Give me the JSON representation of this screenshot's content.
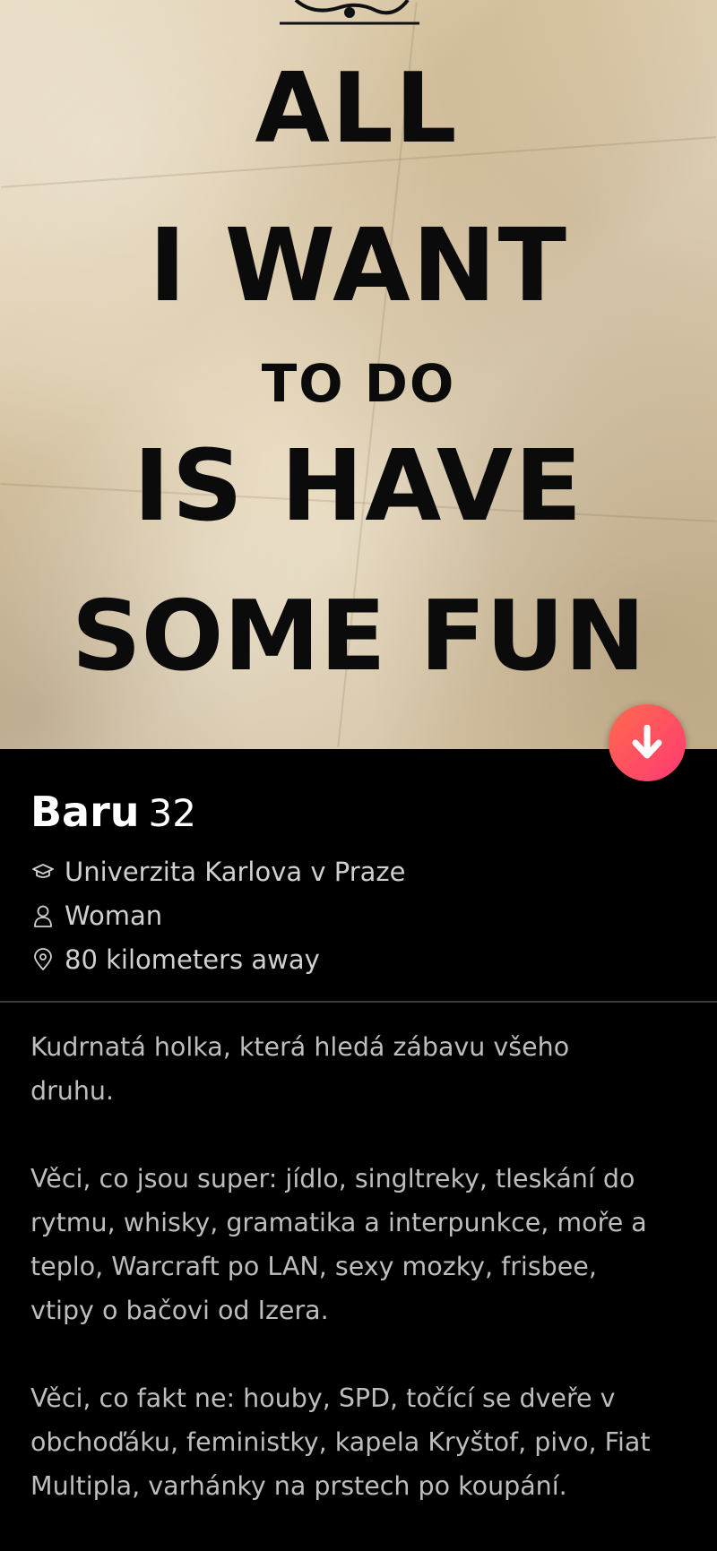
{
  "photo": {
    "poster_lines": [
      "ALL",
      "I WANT",
      "TO DO",
      "IS HAVE",
      "SOME FUN"
    ]
  },
  "profile": {
    "name": "Baru",
    "age": "32",
    "school": "Univerzita Karlova v Praze",
    "gender": "Woman",
    "distance": "80 kilometers away"
  },
  "bio": {
    "paragraph_1": [
      "Kudrnatá holka, která hledá zábavu všeho",
      "druhu."
    ],
    "paragraph_2": [
      "Věci, co jsou super: jídlo, singltreky, tleskání do",
      "rytmu, whisky, gramatika a interpunkce, moře a",
      "teplo, Warcraft po LAN, sexy mozky, frisbee,",
      "vtipy o bačovi od Izera."
    ],
    "paragraph_3": [
      "Věci, co fakt ne: houby, SPD, točící se dveře v",
      "obchoďáku, feministky, kapela Kryštof, pivo, Fiat",
      "Multipla, varhánky na prstech po koupání."
    ]
  },
  "icons": {
    "scroll_down": "arrow-down-icon",
    "school": "graduation-cap-icon",
    "gender": "person-icon",
    "distance": "location-pin-icon"
  },
  "colors": {
    "background": "#000000",
    "accent_gradient_start": "#ff6a4d",
    "accent_gradient_end": "#fd3a73",
    "primary_text": "#ffffff",
    "secondary_text": "#d0d0d0",
    "bio_text": "#bdbdbd"
  }
}
